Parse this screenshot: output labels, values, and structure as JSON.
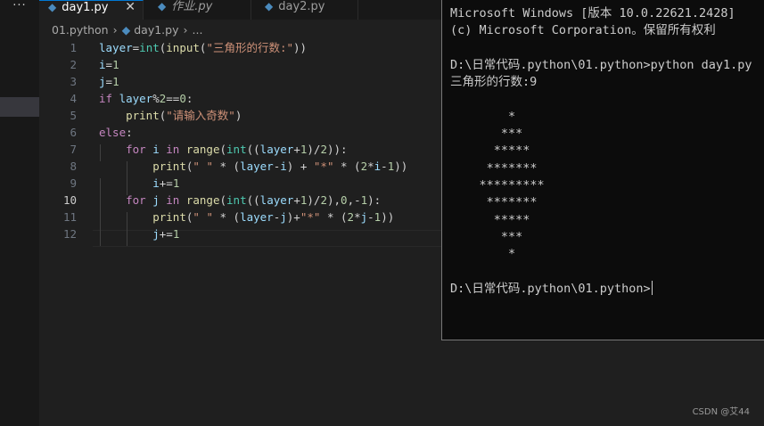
{
  "activity_bar": {
    "more_label": "···"
  },
  "tabs": [
    {
      "label": "day1.py",
      "active": true,
      "close": "✕"
    },
    {
      "label": "作业.py",
      "active": false
    },
    {
      "label": "day2.py",
      "active": false
    }
  ],
  "breadcrumb": {
    "folder": "01.python",
    "file": "day1.py",
    "more": "..."
  },
  "editor": {
    "line_numbers": [
      "1",
      "2",
      "3",
      "4",
      "5",
      "6",
      "7",
      "8",
      "9",
      "10",
      "11",
      "12"
    ],
    "current_line": "10",
    "lines": [
      [
        [
          "va",
          "layer"
        ],
        [
          "op",
          "="
        ],
        [
          "bi",
          "int"
        ],
        [
          "op",
          "("
        ],
        [
          "fn",
          "input"
        ],
        [
          "op",
          "("
        ],
        [
          "st",
          "\"三角形的行数:\""
        ],
        [
          "op",
          "))"
        ]
      ],
      [
        [
          "va",
          "i"
        ],
        [
          "op",
          "="
        ],
        [
          "nm",
          "1"
        ]
      ],
      [
        [
          "va",
          "j"
        ],
        [
          "op",
          "="
        ],
        [
          "nm",
          "1"
        ]
      ],
      [
        [
          "kw",
          "if "
        ],
        [
          "va",
          "layer"
        ],
        [
          "op",
          "%"
        ],
        [
          "nm",
          "2"
        ],
        [
          "op",
          "=="
        ],
        [
          "nm",
          "0"
        ],
        [
          "op",
          ":"
        ]
      ],
      [
        [
          "op",
          "    "
        ],
        [
          "fn",
          "print"
        ],
        [
          "op",
          "("
        ],
        [
          "st",
          "\"请输入奇数\""
        ],
        [
          "op",
          ")"
        ]
      ],
      [
        [
          "kw",
          "else"
        ],
        [
          "op",
          ":"
        ]
      ],
      [
        [
          "op",
          "    "
        ],
        [
          "kw",
          "for "
        ],
        [
          "va",
          "i"
        ],
        [
          "kw",
          " in "
        ],
        [
          "fn",
          "range"
        ],
        [
          "op",
          "("
        ],
        [
          "bi",
          "int"
        ],
        [
          "op",
          "(("
        ],
        [
          "va",
          "layer"
        ],
        [
          "op",
          "+"
        ],
        [
          "nm",
          "1"
        ],
        [
          "op",
          ")/"
        ],
        [
          "nm",
          "2"
        ],
        [
          "op",
          "))"
        ],
        [
          "op",
          ":"
        ]
      ],
      [
        [
          "op",
          "        "
        ],
        [
          "fn",
          "print"
        ],
        [
          "op",
          "("
        ],
        [
          "st",
          "\" \""
        ],
        [
          "op",
          " * ("
        ],
        [
          "va",
          "layer"
        ],
        [
          "op",
          "-"
        ],
        [
          "va",
          "i"
        ],
        [
          "op",
          ") + "
        ],
        [
          "st",
          "\"*\""
        ],
        [
          "op",
          " * ("
        ],
        [
          "nm",
          "2"
        ],
        [
          "op",
          "*"
        ],
        [
          "va",
          "i"
        ],
        [
          "op",
          "-"
        ],
        [
          "nm",
          "1"
        ],
        [
          "op",
          "))"
        ]
      ],
      [
        [
          "op",
          "        "
        ],
        [
          "va",
          "i"
        ],
        [
          "op",
          "+="
        ],
        [
          "nm",
          "1"
        ]
      ],
      [
        [
          "op",
          "    "
        ],
        [
          "kw",
          "for "
        ],
        [
          "va",
          "j"
        ],
        [
          "kw",
          " in "
        ],
        [
          "fn",
          "range"
        ],
        [
          "op",
          "("
        ],
        [
          "bi",
          "int"
        ],
        [
          "op",
          "(("
        ],
        [
          "va",
          "layer"
        ],
        [
          "op",
          "+"
        ],
        [
          "nm",
          "1"
        ],
        [
          "op",
          ")/"
        ],
        [
          "nm",
          "2"
        ],
        [
          "op",
          "),"
        ],
        [
          "nm",
          "0"
        ],
        [
          "op",
          ","
        ],
        [
          "op",
          "-"
        ],
        [
          "nm",
          "1"
        ],
        [
          "op",
          "):"
        ]
      ],
      [
        [
          "op",
          "        "
        ],
        [
          "fn",
          "print"
        ],
        [
          "op",
          "("
        ],
        [
          "st",
          "\" \""
        ],
        [
          "op",
          " * ("
        ],
        [
          "va",
          "layer"
        ],
        [
          "op",
          "-"
        ],
        [
          "va",
          "j"
        ],
        [
          "op",
          ")+"
        ],
        [
          "st",
          "\"*\""
        ],
        [
          "op",
          " * ("
        ],
        [
          "nm",
          "2"
        ],
        [
          "op",
          "*"
        ],
        [
          "va",
          "j"
        ],
        [
          "op",
          "-"
        ],
        [
          "nm",
          "1"
        ],
        [
          "op",
          "))"
        ]
      ],
      [
        [
          "op",
          "        "
        ],
        [
          "va",
          "j"
        ],
        [
          "op",
          "+="
        ],
        [
          "nm",
          "1"
        ]
      ]
    ]
  },
  "terminal": {
    "lines": [
      "Microsoft Windows [版本 10.0.22621.2428]",
      "(c) Microsoft Corporation。保留所有权利",
      "",
      "D:\\日常代码.python\\01.python>python day1.py",
      "三角形的行数:9",
      "",
      "        *",
      "       ***",
      "      *****",
      "     *******",
      "    *********",
      "     *******",
      "      *****",
      "       ***",
      "        *",
      "",
      "D:\\日常代码.python\\01.python>"
    ]
  },
  "watermark": "CSDN @艾44"
}
